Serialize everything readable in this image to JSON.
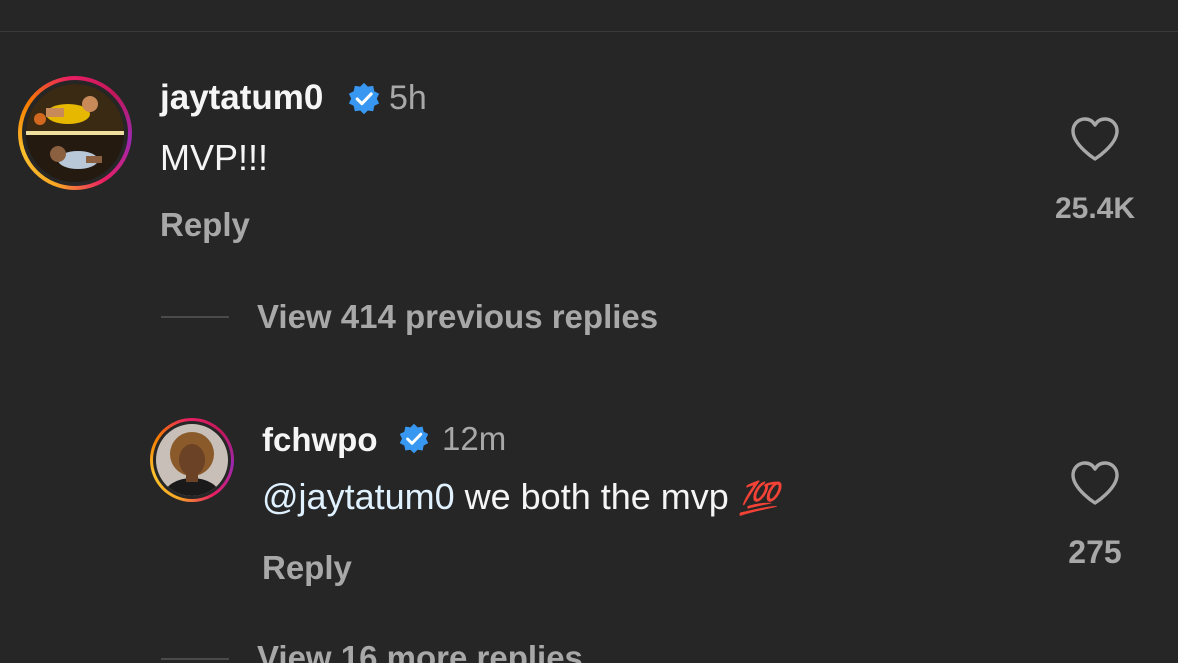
{
  "comments": [
    {
      "username": "jaytatum0",
      "verified": true,
      "time": "5h",
      "text": "MVP!!!",
      "reply_label": "Reply",
      "likes": "25.4K"
    }
  ],
  "thread": {
    "view_previous_label": "View 414 previous replies",
    "reply": {
      "username": "fchwpo",
      "verified": true,
      "time": "12m",
      "mention": "@jaytatum0",
      "text": " we both the mvp ",
      "emoji": "💯",
      "reply_label": "Reply",
      "likes": "275"
    },
    "view_more_label": "View 16 more replies"
  },
  "colors": {
    "background": "#262626",
    "verified_blue": "#3897f0",
    "secondary_text": "#a8a8a8",
    "primary_text": "#f5f5f5"
  },
  "icons": {
    "verified": "verified-badge-icon",
    "like": "heart-outline-icon"
  }
}
